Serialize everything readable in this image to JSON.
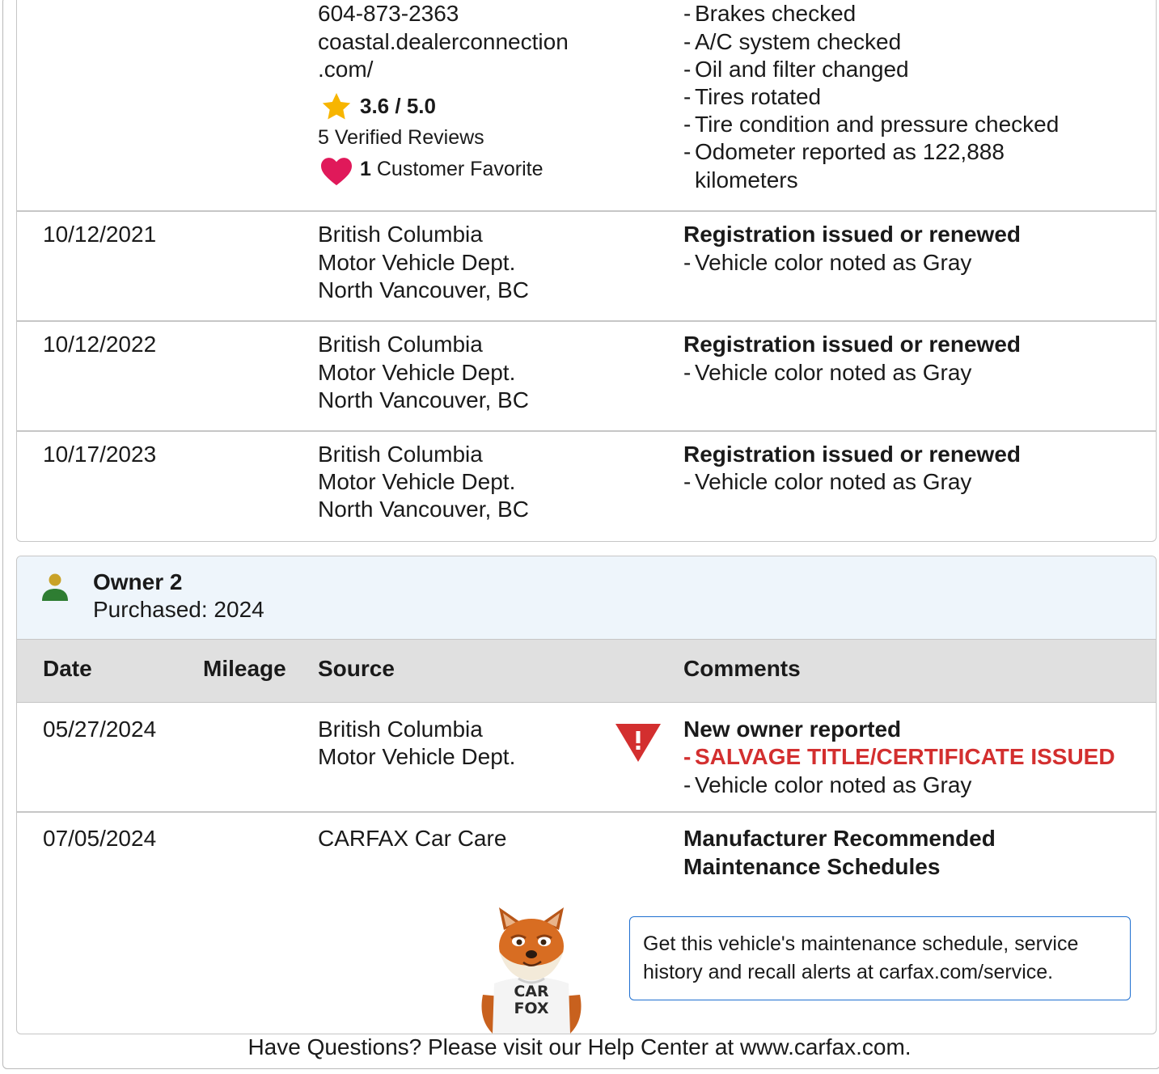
{
  "owner1": {
    "partial_record": {
      "source": {
        "phone": "604-873-2363",
        "url_line1": "coastal.dealerconnection",
        "url_line2": ".com/",
        "rating": "3.6 / 5.0",
        "reviews": "5 Verified Reviews",
        "favorite_count": "1",
        "favorite_label": "Customer Favorite"
      },
      "comments": [
        "Brakes checked",
        "A/C system checked",
        "Oil and filter changed",
        "Tires rotated",
        "Tire condition and pressure checked",
        "Odometer reported as 122,888",
        "kilometers"
      ]
    },
    "records": [
      {
        "date": "10/12/2021",
        "source": [
          "British Columbia",
          "Motor Vehicle Dept.",
          "North Vancouver, BC"
        ],
        "title": "Registration issued or renewed",
        "comments": [
          "Vehicle color noted as Gray"
        ]
      },
      {
        "date": "10/12/2022",
        "source": [
          "British Columbia",
          "Motor Vehicle Dept.",
          "North Vancouver, BC"
        ],
        "title": "Registration issued or renewed",
        "comments": [
          "Vehicle color noted as Gray"
        ]
      },
      {
        "date": "10/17/2023",
        "source": [
          "British Columbia",
          "Motor Vehicle Dept.",
          "North Vancouver, BC"
        ],
        "title": "Registration issued or renewed",
        "comments": [
          "Vehicle color noted as Gray"
        ]
      }
    ]
  },
  "owner2": {
    "title": "Owner 2",
    "purchased": "Purchased: 2024",
    "headers": {
      "date": "Date",
      "mileage": "Mileage",
      "source": "Source",
      "comments": "Comments"
    },
    "records": [
      {
        "date": "05/27/2024",
        "source": [
          "British Columbia",
          "Motor Vehicle Dept."
        ],
        "title": "New owner reported",
        "alert": "SALVAGE TITLE/CERTIFICATE ISSUED",
        "comments": [
          "Vehicle color noted as Gray"
        ]
      },
      {
        "date": "07/05/2024",
        "source": [
          "CARFAX Car Care"
        ],
        "title_line1": "Manufacturer Recommended",
        "title_line2": "Maintenance Schedules",
        "info": "Get this vehicle's maintenance schedule, service history and recall alerts at carfax.com/service.",
        "mascot_shirt_line1": "CAR",
        "mascot_shirt_line2": "FOX"
      }
    ]
  },
  "footer": "Have Questions? Please visit our Help Center at www.carfax.com.",
  "colors": {
    "alert_red": "#d32f2f",
    "star": "#f7b500",
    "heart": "#e0195a",
    "owner_icon_head": "#c9a227",
    "owner_icon_body": "#2e7d32",
    "info_border": "#1e6fd0"
  },
  "icons": [
    "star-icon",
    "heart-icon",
    "person-icon",
    "warning-triangle-icon",
    "carfax-fox-mascot"
  ]
}
